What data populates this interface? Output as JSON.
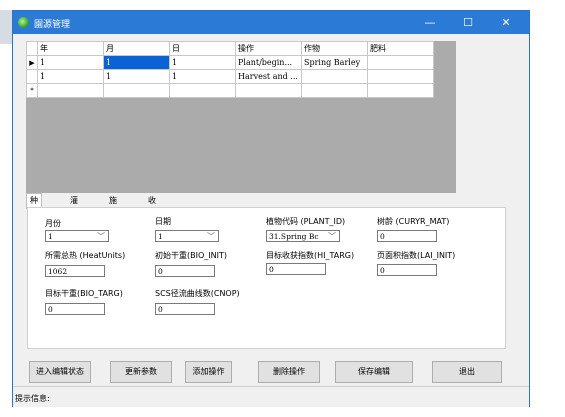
{
  "window": {
    "title": "園源管理",
    "minimize_glyph": "—",
    "maximize_glyph": "☐",
    "close_glyph": "✕"
  },
  "grid": {
    "columns": [
      "年",
      "月",
      "日",
      "操作",
      "作物",
      "肥料"
    ],
    "rows": [
      {
        "indicator": "▶",
        "cells": [
          "1",
          "1",
          "1",
          "Plant/begin...",
          "Spring Barley",
          ""
        ]
      },
      {
        "indicator": "",
        "cells": [
          "1",
          "1",
          "1",
          "Harvest and ...",
          "",
          ""
        ]
      },
      {
        "indicator": "*",
        "cells": [
          "",
          "",
          "",
          "",
          "",
          ""
        ]
      }
    ]
  },
  "tabs": [
    "种植操作",
    "灌溉操作",
    "施肥操作",
    "收割操作"
  ],
  "form": {
    "month_label": "月份",
    "month_value": "1",
    "day_label": "日期",
    "day_value": "1",
    "plant_id_label": "植物代码 (PLANT_ID)",
    "plant_id_value": "31.Spring Bc",
    "curyr_label": "树龄 (CURYR_MAT)",
    "curyr_value": "0",
    "heat_label": "所需总热 (HeatUnits)",
    "heat_value": "1062",
    "bio_init_label": "初始干重(BIO_INIT)",
    "bio_init_value": "0",
    "hi_targ_label": "目标收获指数(HI_TARG)",
    "hi_targ_value": "0",
    "lai_label": "页面积指数(LAI_INIT)",
    "lai_value": "0",
    "bio_targ_label": "目标干重(BIO_TARG)",
    "bio_targ_value": "0",
    "cnop_label": "SCS径流曲线数(CNOP)",
    "cnop_value": "0"
  },
  "buttons": {
    "edit": "进入编辑状态",
    "update": "更新参数",
    "add": "添加操作",
    "delete": "删除操作",
    "save": "保存编辑",
    "exit": "退出"
  },
  "status": "提示信息:"
}
